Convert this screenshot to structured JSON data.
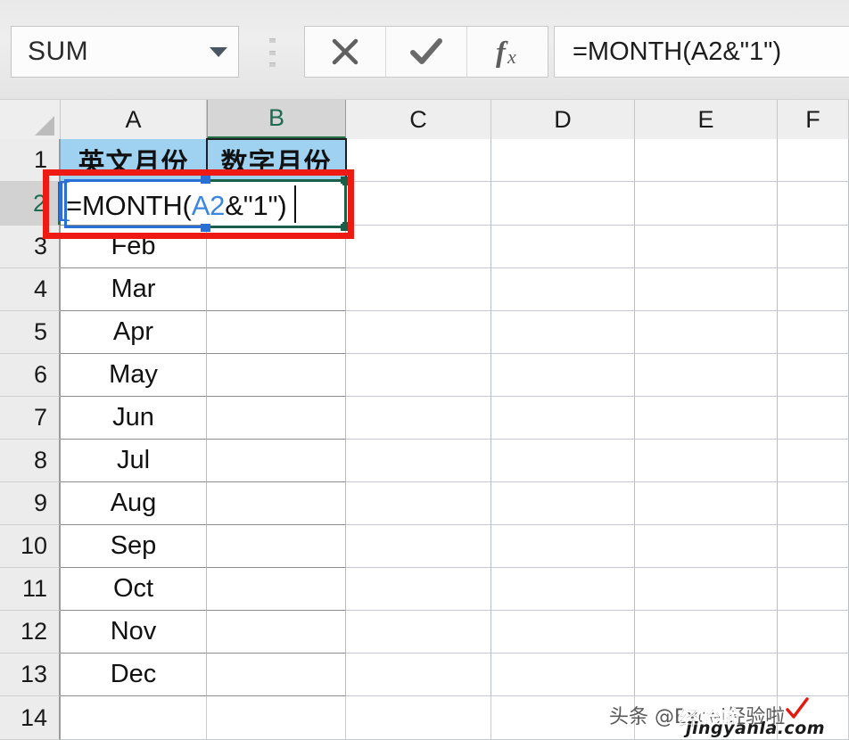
{
  "formula_bar": {
    "name_box_value": "SUM",
    "name_box_dropdown_icon": "chevron-down-icon",
    "grip_icon": "drag-grip-icon",
    "cancel_icon": "close-x-icon",
    "enter_icon": "checkmark-icon",
    "insert_function_icon": "fx-icon",
    "insert_function_label": "fx",
    "formula_value": "=MONTH(A2&\"1\")"
  },
  "grid": {
    "select_all_icon": "select-all-triangle-icon",
    "column_headers": [
      "A",
      "B",
      "C",
      "D",
      "E",
      "F"
    ],
    "active_column": "B",
    "row_headers": [
      "1",
      "2",
      "3",
      "4",
      "5",
      "6",
      "7",
      "8",
      "9",
      "10",
      "11",
      "12",
      "13",
      "14"
    ],
    "active_row": "2",
    "header_row": {
      "A": "英文月份",
      "B": "数字月份",
      "fill_color": "#9ed2f0"
    },
    "column_a_values": [
      "",
      "Feb",
      "Mar",
      "Apr",
      "May",
      "Jun",
      "Jul",
      "Aug",
      "Sep",
      "Oct",
      "Nov",
      "Dec",
      ""
    ],
    "column_b_values": [
      "",
      "",
      "",
      "",
      "",
      "",
      "",
      "",
      "",
      "",
      "",
      "",
      ""
    ]
  },
  "cell_editor": {
    "active_cell": "B2",
    "text_prefix": "=MONTH(",
    "text_reference": "A2",
    "text_suffix": "&\"1\")",
    "reference_cell": "A2",
    "reference_border_color": "#2a6fd6",
    "edit_border_color": "#1b5e4a",
    "reference_text_color": "#3b86e0"
  },
  "annotation": {
    "shape": "rectangle",
    "color": "#ee1b14",
    "target": "B2 formula editor"
  },
  "watermark": {
    "main": "头条 @Excel经验啦",
    "overlay": "经验啦",
    "domain": "jingyanla.com",
    "check_icon": "red-check-icon"
  }
}
